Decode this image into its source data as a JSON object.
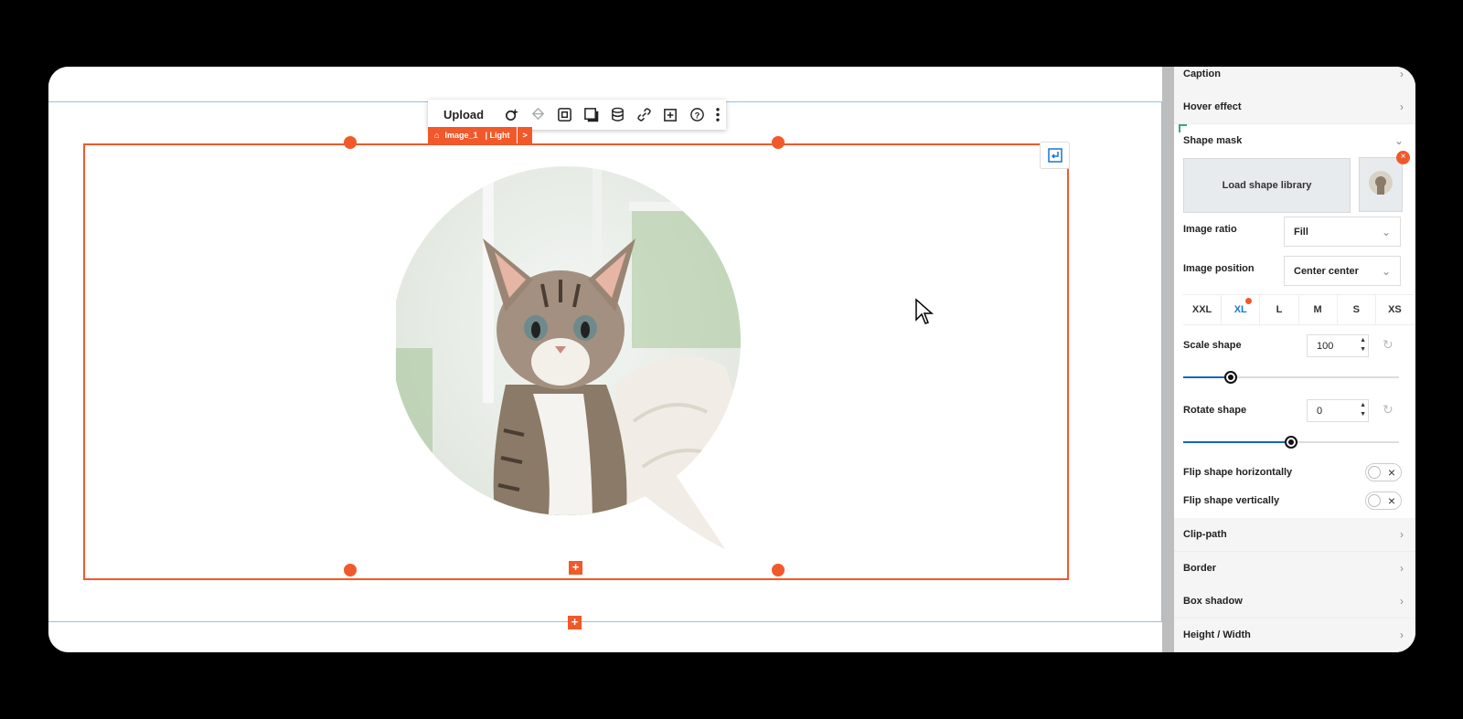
{
  "toolbar": {
    "upload_label": "Upload",
    "icons": [
      "magic-wand-icon",
      "layers-icon",
      "frame-icon",
      "shadow-icon",
      "database-icon",
      "link-icon",
      "add-box-icon",
      "help-icon",
      "more-vertical-icon"
    ]
  },
  "element_tag": {
    "name": "Image_1",
    "state": "| Light",
    "arrow": ">"
  },
  "panel": {
    "caption": "Caption",
    "hover_effect": "Hover effect",
    "shape_mask": "Shape mask",
    "load_shape_library": "Load shape library",
    "image_ratio": {
      "label": "Image ratio",
      "value": "Fill"
    },
    "image_position": {
      "label": "Image position",
      "value": "Center center"
    },
    "breakpoints": [
      "XXL",
      "XL",
      "L",
      "M",
      "S",
      "XS"
    ],
    "active_breakpoint": "XL",
    "scale_shape": {
      "label": "Scale shape",
      "value": "100",
      "slider_fraction": 0.22
    },
    "rotate_shape": {
      "label": "Rotate shape",
      "value": "0",
      "slider_fraction": 0.5
    },
    "flip_horizontal": {
      "label": "Flip shape horizontally",
      "on": false
    },
    "flip_vertical": {
      "label": "Flip shape vertically",
      "on": false
    },
    "clip_path": "Clip-path",
    "border": "Border",
    "box_shadow": "Box shadow",
    "height_width": "Height / Width"
  },
  "colors": {
    "accent": "#f1592a",
    "selection_outline": "#8fc3e6",
    "slider_fill": "#1565c0"
  }
}
